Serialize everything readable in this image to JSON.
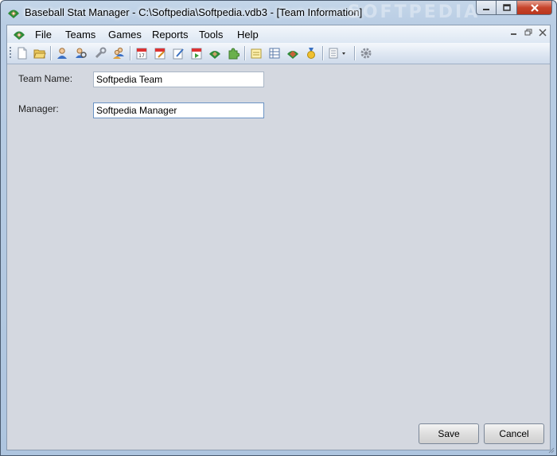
{
  "window": {
    "title": "Baseball Stat Manager - C:\\Softpedia\\Softpedia.vdb3 - [Team Information]",
    "watermark": "SOFTPEDIA"
  },
  "menu": {
    "items": [
      "File",
      "Teams",
      "Games",
      "Reports",
      "Tools",
      "Help"
    ]
  },
  "toolbar": {
    "icons": [
      "new-file-icon",
      "open-folder-icon",
      "player-icon",
      "player-search-icon",
      "wrench-icon",
      "players-icon",
      "calendar-icon",
      "calendar-edit-icon",
      "edit-icon",
      "calendar-arrow-icon",
      "field-icon",
      "puzzle-icon",
      "notes-icon",
      "table-icon",
      "diamond-field-icon",
      "medal-icon",
      "report-dropdown-icon",
      "settings-icon"
    ]
  },
  "form": {
    "team_name_label": "Team Name:",
    "team_name_value": "Softpedia Team",
    "manager_label": "Manager:",
    "manager_value": "Softpedia Manager"
  },
  "buttons": {
    "save": "Save",
    "cancel": "Cancel"
  },
  "colors": {
    "accent": "#6a93c4",
    "close_red": "#c7452c",
    "content_bg": "#d4d8e0"
  }
}
